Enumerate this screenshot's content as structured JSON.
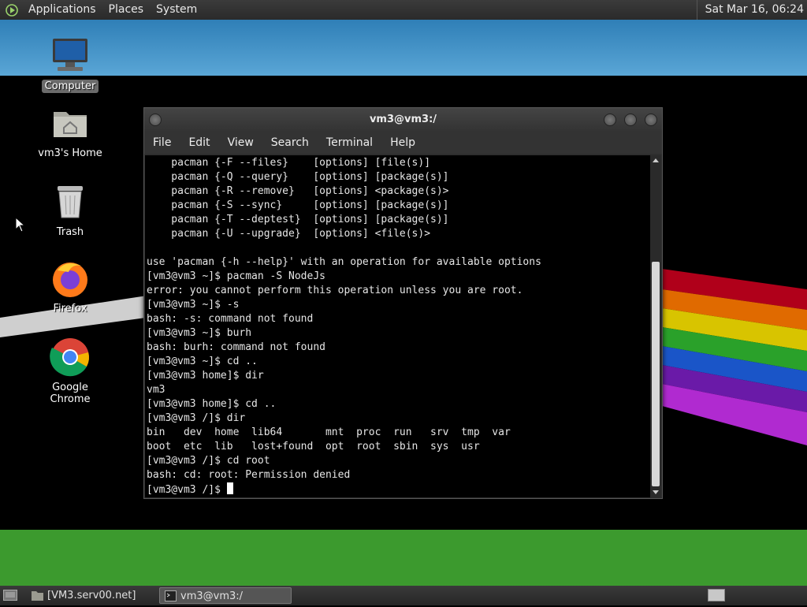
{
  "top_panel": {
    "menus": [
      "Applications",
      "Places",
      "System"
    ],
    "clock": "Sat Mar 16, 06:24"
  },
  "desktop_icons": [
    {
      "label": "Computer",
      "icon": "computer-icon"
    },
    {
      "label": "vm3's Home",
      "icon": "home-folder-icon"
    },
    {
      "label": "Trash",
      "icon": "trash-icon"
    },
    {
      "label": "Firefox",
      "icon": "firefox-icon"
    },
    {
      "label": "Google Chrome",
      "icon": "chrome-icon"
    }
  ],
  "terminal": {
    "title": "vm3@vm3:/",
    "menus": [
      "File",
      "Edit",
      "View",
      "Search",
      "Terminal",
      "Help"
    ],
    "lines": [
      "    pacman {-F --files}    [options] [file(s)]",
      "    pacman {-Q --query}    [options] [package(s)]",
      "    pacman {-R --remove}   [options] <package(s)>",
      "    pacman {-S --sync}     [options] [package(s)]",
      "    pacman {-T --deptest}  [options] [package(s)]",
      "    pacman {-U --upgrade}  [options] <file(s)>",
      "",
      "use 'pacman {-h --help}' with an operation for available options",
      "[vm3@vm3 ~]$ pacman -S NodeJs",
      "error: you cannot perform this operation unless you are root.",
      "[vm3@vm3 ~]$ -s",
      "bash: -s: command not found",
      "[vm3@vm3 ~]$ burh",
      "bash: burh: command not found",
      "[vm3@vm3 ~]$ cd ..",
      "[vm3@vm3 home]$ dir",
      "vm3",
      "[vm3@vm3 home]$ cd ..",
      "[vm3@vm3 /]$ dir",
      "bin   dev  home  lib64       mnt  proc  run   srv  tmp  var",
      "boot  etc  lib   lost+found  opt  root  sbin  sys  usr",
      "[vm3@vm3 /]$ cd root",
      "bash: cd: root: Permission denied"
    ],
    "prompt": "[vm3@vm3 /]$ "
  },
  "taskbar": {
    "tasks": [
      {
        "label": "[VM3.serv00.net]",
        "icon": "folder-icon"
      },
      {
        "label": "vm3@vm3:/",
        "icon": "terminal-icon"
      }
    ]
  }
}
